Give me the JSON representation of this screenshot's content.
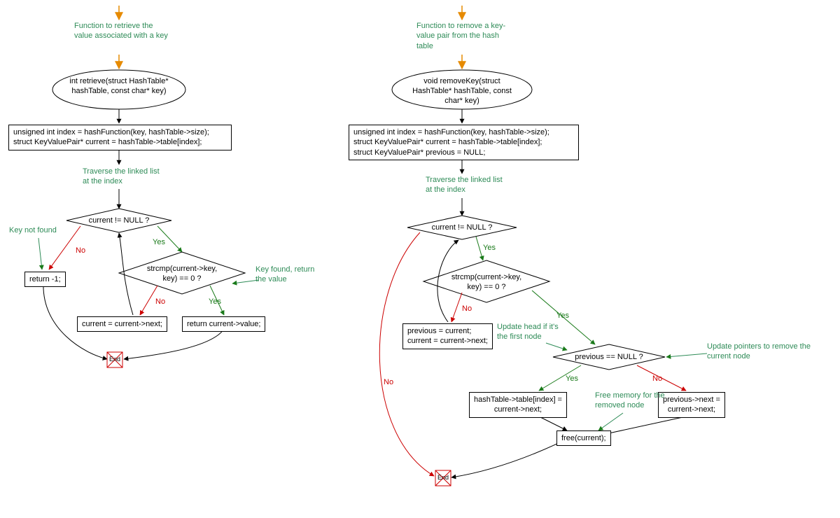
{
  "left": {
    "comment_top": "Function to retrieve the\nvalue associated with\na key",
    "func_sig": "int retrieve(struct\nHashTable* hashTable, const\nchar* key)",
    "init_block": "unsigned int index = hashFunction(key, hashTable->size);\nstruct KeyValuePair* current = hashTable->table[index];",
    "comment_traverse": "Traverse the linked\nlist at the index",
    "cond1": "current != NULL ?",
    "comment_notfound": "Key not found",
    "return_minus1": "return -1;",
    "cond2": "strcmp(current->key,\nkey) == 0 ?",
    "comment_found": "Key found,\nreturn the value",
    "advance": "current = current->next;",
    "return_val": "return current->value;",
    "end": "End"
  },
  "right": {
    "comment_top": "Function to remove a\nkey-value pair from the\nhash table",
    "func_sig": "void removeKey(struct\nHashTable* hashTable, const\nchar* key)",
    "init_block": "unsigned int index = hashFunction(key, hashTable->size);\nstruct KeyValuePair* current = hashTable->table[index];\nstruct KeyValuePair* previous = NULL;",
    "comment_traverse": "Traverse the linked\nlist at the index",
    "cond1": "current != NULL ?",
    "cond2": "strcmp(current->key,\nkey) == 0 ?",
    "advance": "previous = current;\ncurrent = current->next;",
    "comment_updatehead": "Update head if\nit's the first node",
    "cond3": "previous == NULL ?",
    "comment_updateptr": "Update pointers to remove\nthe current node",
    "set_head": "hashTable->table[index] =\ncurrent->next;",
    "set_prev": "previous->next =\ncurrent->next;",
    "comment_free": "Free memory for\nthe removed node",
    "free": "free(current);",
    "end": "End"
  },
  "labels": {
    "yes": "Yes",
    "no": "No"
  }
}
